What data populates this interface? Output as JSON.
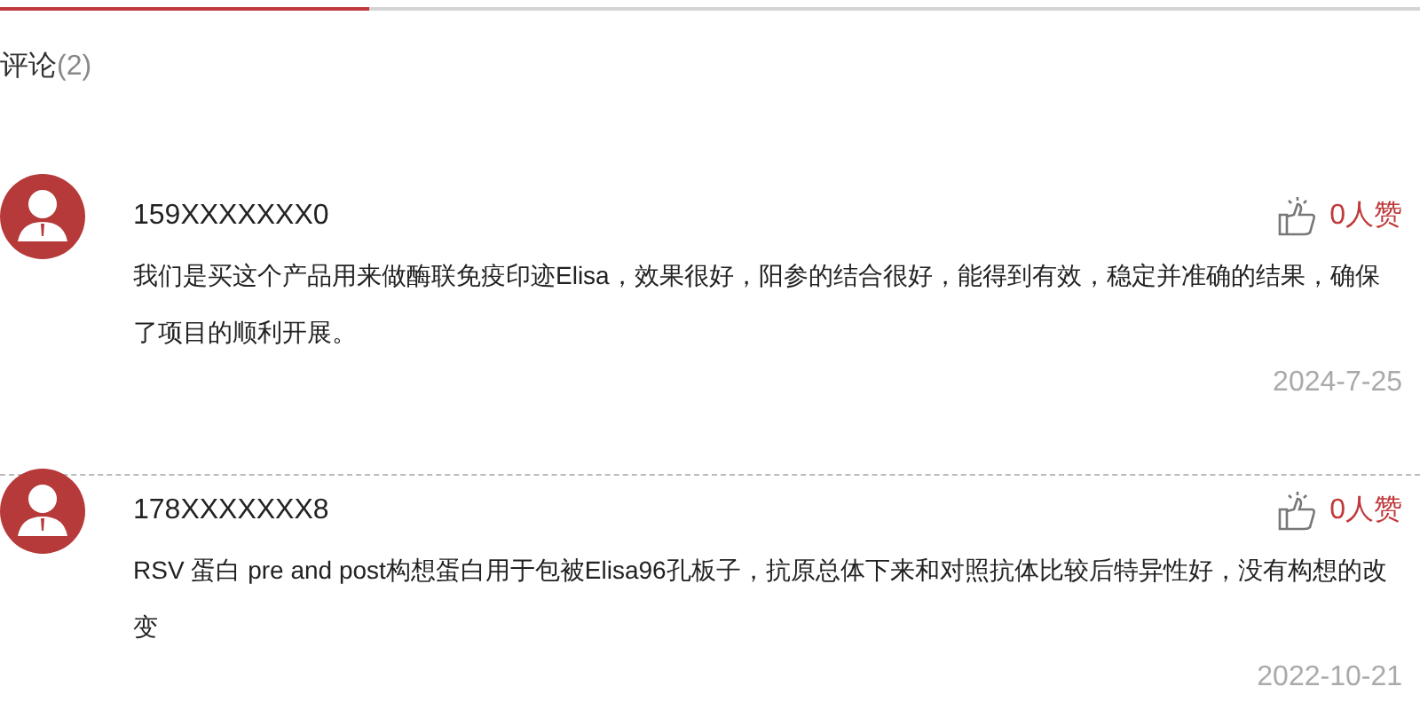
{
  "section": {
    "title": "评论",
    "count": "(2)"
  },
  "comments": [
    {
      "user": "159XXXXXXX0",
      "likes": "0人赞",
      "text": "我们是买这个产品用来做酶联免疫印迹Elisa，效果很好，阳参的结合很好，能得到有效，稳定并准确的结果，确保了项目的顺利开展。",
      "date": "2024-7-25"
    },
    {
      "user": "178XXXXXXX8",
      "likes": "0人赞",
      "text": "RSV 蛋白 pre and post构想蛋白用于包被Elisa96孔板子，抗原总体下来和对照抗体比较后特异性好，没有构想的改变",
      "date": "2022-10-21"
    }
  ]
}
